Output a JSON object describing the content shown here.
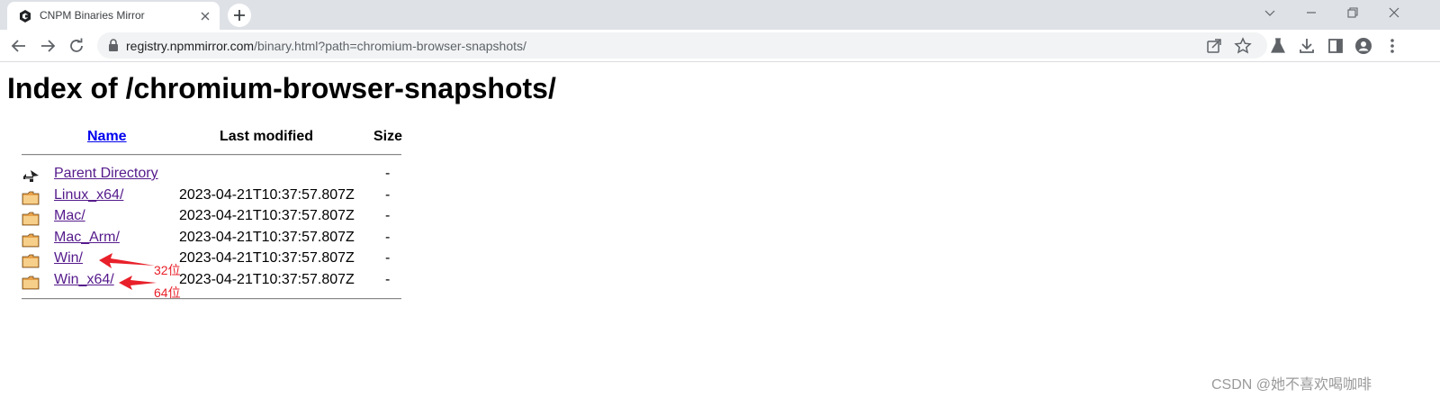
{
  "browser": {
    "tab_title": "CNPM Binaries Mirror",
    "url_host": "registry.npmmirror.com",
    "url_path": "/binary.html?path=chromium-browser-snapshots/"
  },
  "page": {
    "heading": "Index of /chromium-browser-snapshots/",
    "columns": {
      "name": "Name",
      "last_modified": "Last modified",
      "size": "Size"
    },
    "rows": [
      {
        "icon": "parent-directory-icon",
        "name": "Parent Directory",
        "modified": "",
        "size": "-"
      },
      {
        "icon": "folder-icon",
        "name": "Linux_x64/",
        "modified": "2023-04-21T10:37:57.807Z",
        "size": "-"
      },
      {
        "icon": "folder-icon",
        "name": "Mac/",
        "modified": "2023-04-21T10:37:57.807Z",
        "size": "-"
      },
      {
        "icon": "folder-icon",
        "name": "Mac_Arm/",
        "modified": "2023-04-21T10:37:57.807Z",
        "size": "-"
      },
      {
        "icon": "folder-icon",
        "name": "Win/",
        "modified": "2023-04-21T10:37:57.807Z",
        "size": "-"
      },
      {
        "icon": "folder-icon",
        "name": "Win_x64/",
        "modified": "2023-04-21T10:37:57.807Z",
        "size": "-"
      }
    ]
  },
  "annotations": {
    "win32": "32位",
    "win64": "64位",
    "color": "#e8202a"
  },
  "watermark": "CSDN @她不喜欢喝咖啡",
  "colors": {
    "link": "#0000ee",
    "visited_link": "#551a8b",
    "tabstrip": "#dee1e6",
    "omnibox": "#f1f3f4"
  }
}
